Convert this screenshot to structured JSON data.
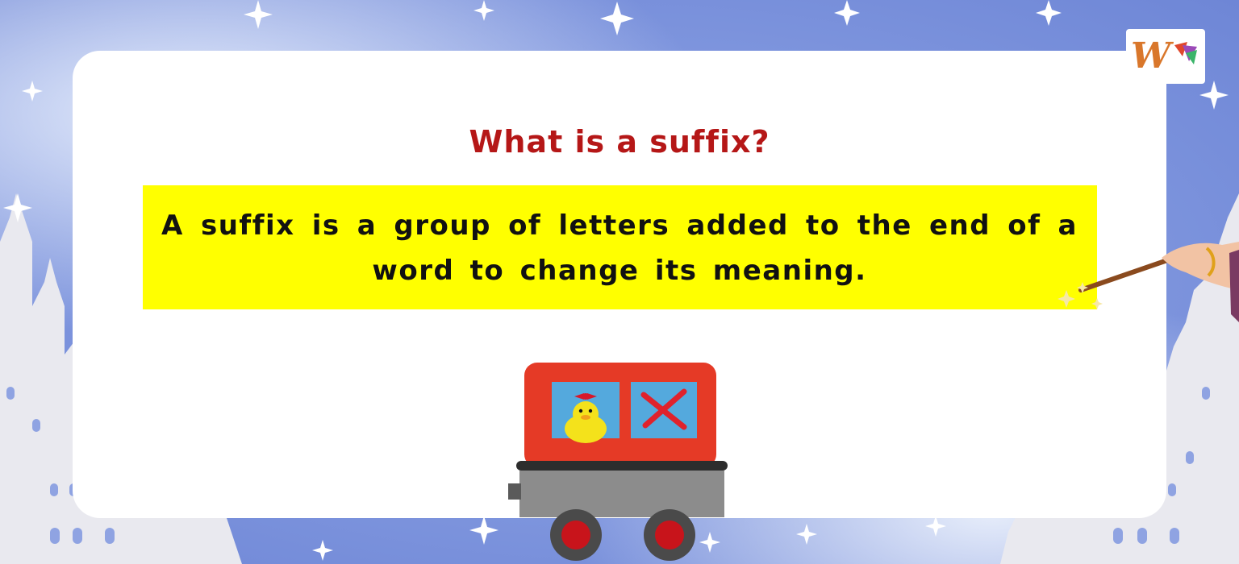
{
  "slide": {
    "title": "What is a suffix?",
    "definition": "A suffix is a group of letters added to the end of a word to change its meaning."
  },
  "logo": {
    "letter": "W"
  },
  "colors": {
    "title": "#b51717",
    "highlight": "#ffff00",
    "cart_red": "#e53a26",
    "window_blue": "#54a9dd",
    "cart_gray": "#8c8c8c",
    "wheel_red": "#c8141b"
  },
  "icons": [
    "logo-icon",
    "sparkle-icon",
    "magic-wand-icon",
    "duck-icon",
    "cross-icon",
    "castle-icon"
  ]
}
